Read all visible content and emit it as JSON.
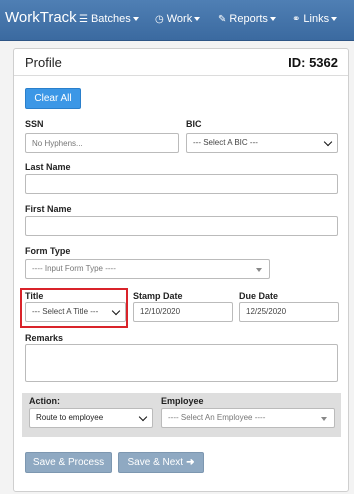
{
  "app": {
    "brand": "WorkTrack"
  },
  "nav": [
    {
      "label": "Batches",
      "icon": "list-icon"
    },
    {
      "label": "Work",
      "icon": "clock-icon"
    },
    {
      "label": "Reports",
      "icon": "pencil-icon"
    },
    {
      "label": "Links",
      "icon": "link-icon"
    }
  ],
  "profile": {
    "title": "Profile",
    "id_label": "ID: 5362",
    "clear_all": "Clear All",
    "ssn": {
      "label": "SSN",
      "placeholder": "No Hyphens..."
    },
    "bic": {
      "label": "BIC",
      "value": "--- Select A BIC ---"
    },
    "last_name": {
      "label": "Last Name",
      "value": ""
    },
    "first_name": {
      "label": "First Name",
      "value": ""
    },
    "form_type": {
      "label": "Form Type",
      "value": "---- Input Form Type ----"
    },
    "title_field": {
      "label": "Title",
      "value": "--- Select A Title ---"
    },
    "stamp_date": {
      "label": "Stamp Date",
      "value": "12/10/2020"
    },
    "due_date": {
      "label": "Due Date",
      "value": "12/25/2020"
    },
    "remarks": {
      "label": "Remarks",
      "value": ""
    },
    "action": {
      "label": "Action:",
      "value": "Route to employee"
    },
    "employee": {
      "label": "Employee",
      "value": "---- Select An Employee ----"
    },
    "save_process": "Save & Process",
    "save_next": "Save & Next"
  },
  "colors": {
    "navbar": "#3f6fa6",
    "primary": "#3c97e6",
    "highlight": "#d9232a",
    "secondary_button": "#8fa9c2"
  }
}
